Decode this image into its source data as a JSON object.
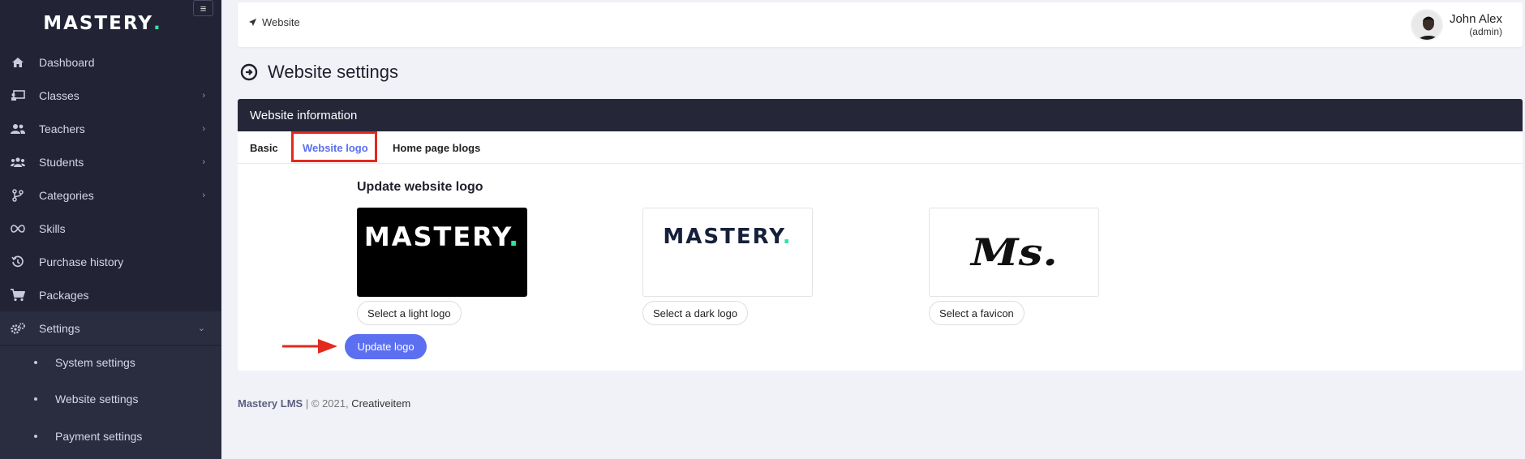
{
  "sidebar": {
    "logo_text": "MASTERY",
    "logo_dot": ".",
    "toggle_icon": "≡",
    "items": [
      {
        "label": "Dashboard",
        "icon": "home-icon",
        "has_chevron": false
      },
      {
        "label": "Classes",
        "icon": "chalkboard-icon",
        "has_chevron": true
      },
      {
        "label": "Teachers",
        "icon": "users-icon",
        "has_chevron": true
      },
      {
        "label": "Students",
        "icon": "user-group-icon",
        "has_chevron": true
      },
      {
        "label": "Categories",
        "icon": "branch-icon",
        "has_chevron": true
      },
      {
        "label": "Skills",
        "icon": "infinity-icon",
        "has_chevron": false
      },
      {
        "label": "Purchase history",
        "icon": "history-icon",
        "has_chevron": false
      },
      {
        "label": "Packages",
        "icon": "cart-icon",
        "has_chevron": false
      },
      {
        "label": "Settings",
        "icon": "cogs-icon",
        "has_chevron": true,
        "expanded": true
      }
    ],
    "subitems": [
      {
        "label": "System settings"
      },
      {
        "label": "Website settings"
      },
      {
        "label": "Payment settings"
      }
    ]
  },
  "topbar": {
    "breadcrumb": "Website",
    "user_name": "John Alex",
    "user_role": "(admin)"
  },
  "page_title": "Website settings",
  "card": {
    "header": "Website information",
    "tabs": [
      {
        "label": "Basic",
        "active": false
      },
      {
        "label": "Website logo",
        "active": true
      },
      {
        "label": "Home page blogs",
        "active": false
      }
    ],
    "section_title": "Update website logo",
    "logos": {
      "light_preview": "MASTERY",
      "dark_preview": "MASTERY",
      "favicon_preview": "Ms."
    },
    "buttons": {
      "select_light": "Select a light logo",
      "select_dark": "Select a dark logo",
      "select_favicon": "Select a favicon",
      "update": "Update logo"
    }
  },
  "footer": {
    "brand": "Mastery LMS",
    "separator": "|",
    "copyright": "© 2021,",
    "company": "Creativeitem"
  },
  "colors": {
    "sidebar_bg": "#222436",
    "accent": "#5b6ff0",
    "logo_dot": "#2ee59d",
    "highlight": "#e22a1d"
  }
}
